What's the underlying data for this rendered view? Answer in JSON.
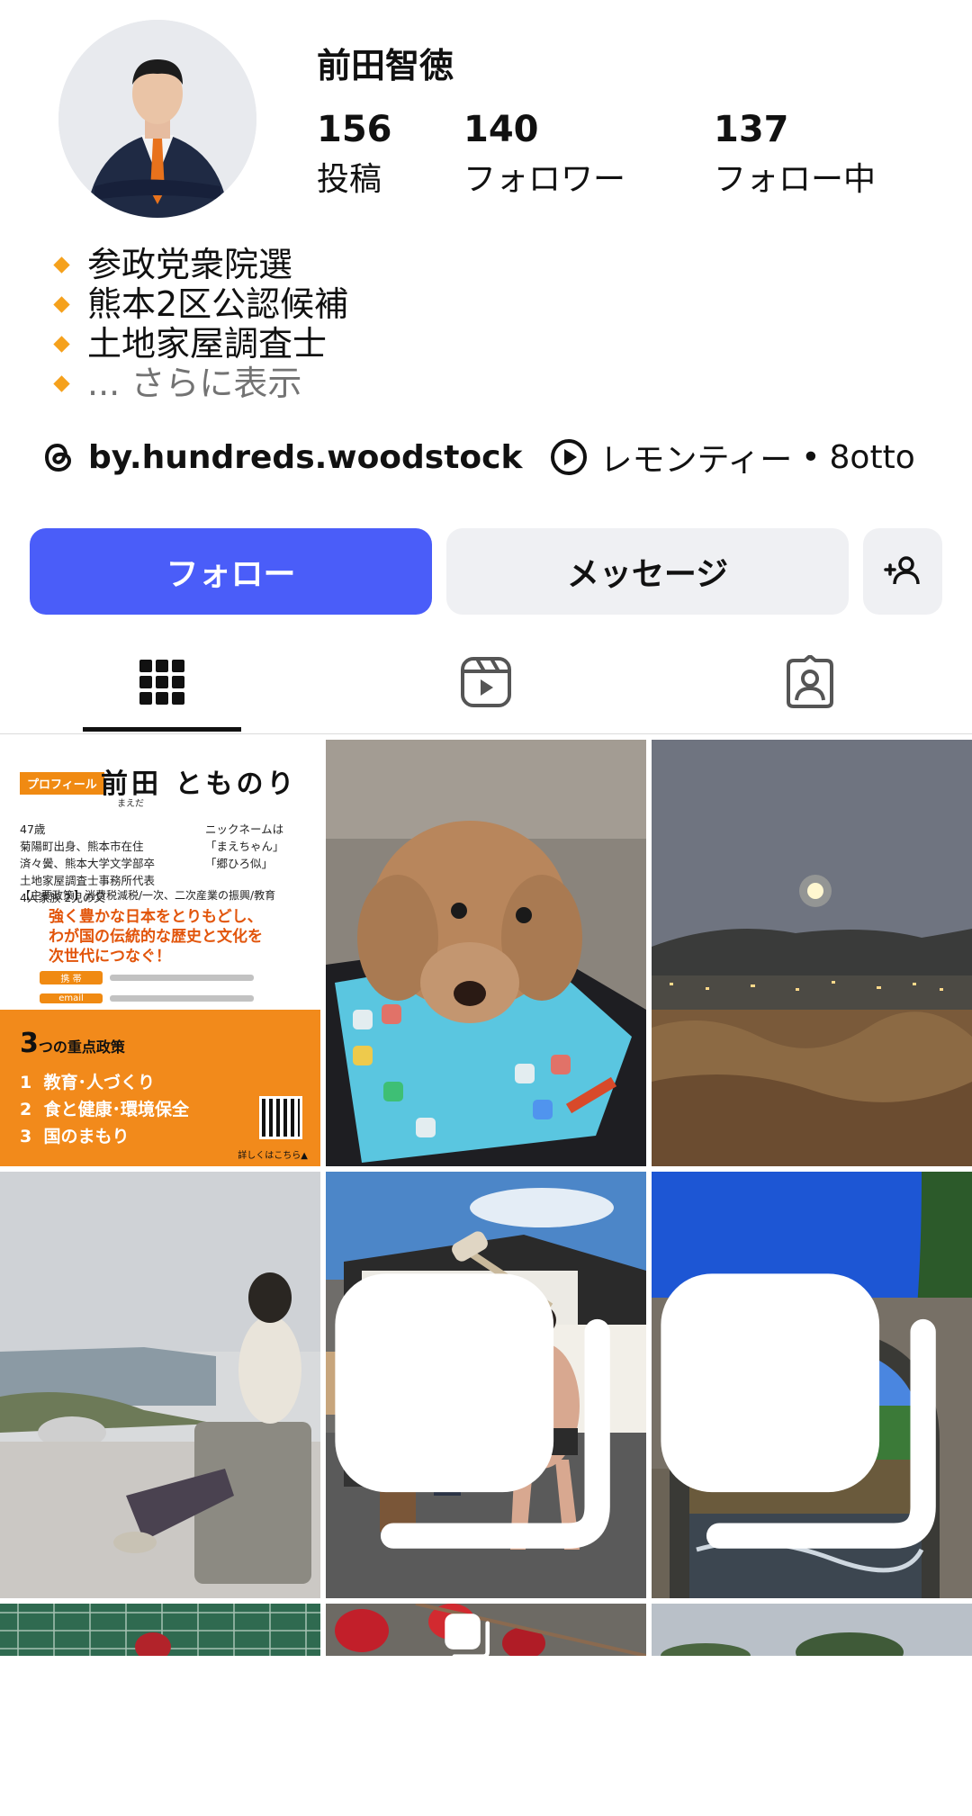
{
  "profile": {
    "name": "前田智徳",
    "stats": {
      "posts_count": "156",
      "posts_label": "投稿",
      "followers_count": "140",
      "followers_label": "フォロワー",
      "following_count": "137",
      "following_label": "フォロー中"
    },
    "bio": [
      "参政党衆院選",
      "熊本2区公認候補",
      "土地家屋調査士"
    ],
    "bio_more": "... さらに表示",
    "threads_handle": "by.hundreds.woodstock",
    "music": {
      "song": "レモンティー",
      "separator": "•",
      "artist": "8otto"
    }
  },
  "actions": {
    "follow_label": "フォロー",
    "message_label": "メッセージ",
    "add_icon": "add-person-icon"
  },
  "tabs": [
    {
      "icon": "grid-icon",
      "active": true
    },
    {
      "icon": "reels-icon",
      "active": false
    },
    {
      "icon": "tagged-icon",
      "active": false
    }
  ],
  "card": {
    "tag": "プロフィール",
    "name": "前田 とものり",
    "ruby": "まえだ",
    "info": "47歳\n菊陽町出身、熊本市在住\n済々黌、熊本大学文学部卒\n土地家屋調査士事務所代表\n4人家族 2児の父",
    "nick": "ニックネームは\n「まえちゃん」\n「郷ひろ似」",
    "policy": "【主要政策】消費税減税/一次、二次産業の振興/教育",
    "slogan": "強く豊かな日本をとりもどし、\nわが国の伝統的な歴史と文化を\n次世代につなぐ！",
    "contact_phone": "携 帯",
    "contact_email": "email",
    "policies_title_num": "3",
    "policies_title": "つの重点政策",
    "policies": "1  教育･人づくり\n2  食と健康･環境保全\n3  国のまもり",
    "more": "詳しくはこちら▲"
  },
  "colors": {
    "accent": "#4a5df9",
    "brand_orange": "#f28a1b",
    "bio_bullet": "#f5a11c"
  }
}
